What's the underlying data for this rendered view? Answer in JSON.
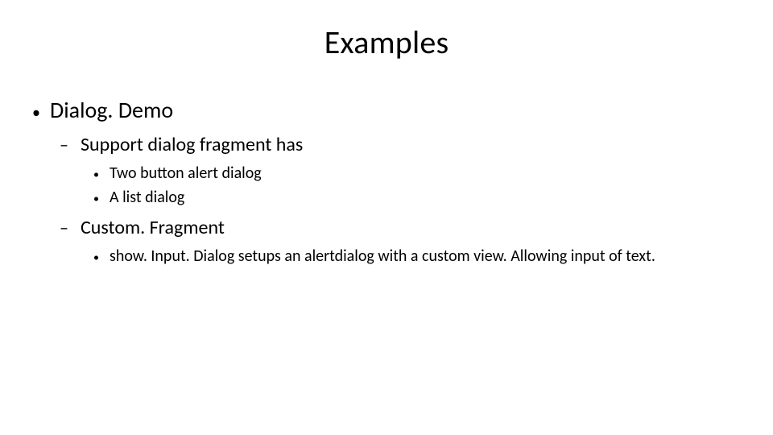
{
  "title": "Examples",
  "b1": {
    "label": "Dialog. Demo"
  },
  "b1s1": {
    "label": "Support dialog fragment has"
  },
  "b1s1i1": "Two button alert dialog",
  "b1s1i2": "A list dialog",
  "b1s2": {
    "label": "Custom. Fragment"
  },
  "b1s2i1": "show. Input. Dialog setups an alertdialog with a custom view.  Allowing input of text."
}
